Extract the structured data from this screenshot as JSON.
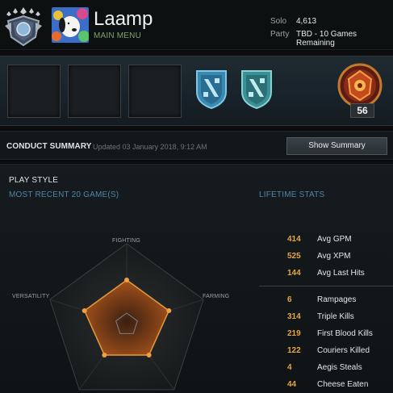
{
  "header": {
    "player_name": "Laamp",
    "subtitle": "MAIN MENU",
    "solo_label": "Solo",
    "solo_value": "4,613",
    "party_label": "Party",
    "party_value": "TBD - 10 Games Remaining"
  },
  "showcase": {
    "level": "56"
  },
  "conduct": {
    "title": "CONDUCT SUMMARY",
    "updated": "Updated 03 January 2018, 9:12 AM",
    "button_label": "Show Summary"
  },
  "playstyle": {
    "title": "PLAY STYLE",
    "recent": "MOST RECENT 20 GAME(S)",
    "lifetime": "LIFETIME STATS",
    "radar_labels": {
      "fighting": "FIGHTING",
      "farming": "FARMING",
      "versatility": "VERSATILITY"
    },
    "radar_values": {
      "fighting": 0.55,
      "farming": 0.55,
      "lower_right": 0.47,
      "lower_left": 0.47,
      "versatility": 0.55
    }
  },
  "lifetime_stats": [
    {
      "value": "414",
      "label": "Avg GPM"
    },
    {
      "value": "525",
      "label": "Avg XPM"
    },
    {
      "value": "144",
      "label": "Avg Last Hits"
    },
    {
      "value": "6",
      "label": "Rampages"
    },
    {
      "value": "314",
      "label": "Triple Kills"
    },
    {
      "value": "219",
      "label": "First Blood Kills"
    },
    {
      "value": "122",
      "label": "Couriers Killed"
    },
    {
      "value": "4",
      "label": "Aegis Steals"
    },
    {
      "value": "44",
      "label": "Cheese Eaten"
    }
  ],
  "colors": {
    "accent_orange": "#e6a544",
    "section_blue": "#4f86a6",
    "menu_green": "#7fa36a"
  }
}
